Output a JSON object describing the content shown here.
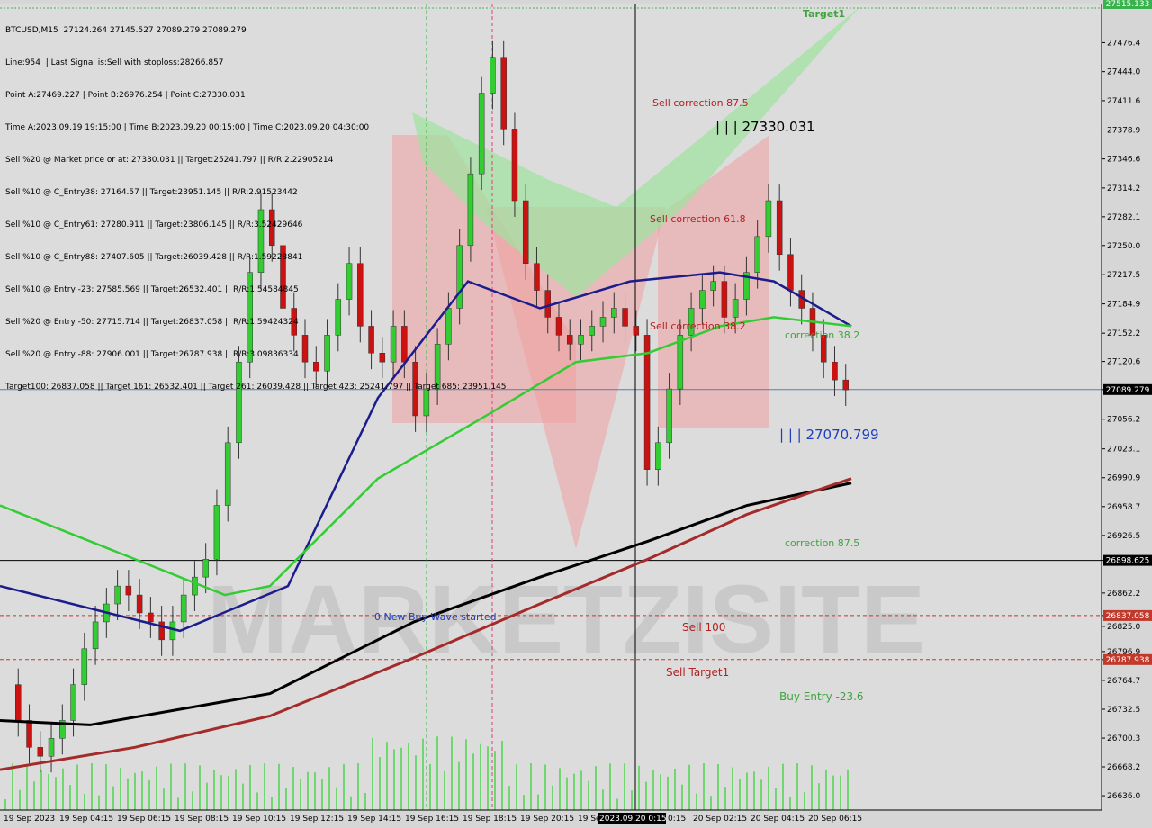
{
  "header": {
    "symbol_line": "BTCUSD,M15  27124.264 27145.527 27089.279 27089.279",
    "lines": [
      "Line:954  | Last Signal is:Sell with stoploss:28266.857",
      "Point A:27469.227 | Point B:26976.254 | Point C:27330.031",
      "Time A:2023.09.19 19:15:00 | Time B:2023.09.20 00:15:00 | Time C:2023.09.20 04:30:00",
      "Sell %20 @ Market price or at: 27330.031 || Target:25241.797 || R/R:2.22905214",
      "Sell %10 @ C_Entry38: 27164.57 || Target:23951.145 || R/R:2.91523442",
      "Sell %10 @ C_Entry61: 27280.911 || Target:23806.145 || R/R:3.52429646",
      "Sell %10 @ C_Entry88: 27407.605 || Target:26039.428 || R/R:1.59228841",
      "Sell %10 @ Entry -23: 27585.569 || Target:26532.401 || R/R:1.54584845",
      "Sell %20 @ Entry -50: 27715.714 || Target:26837.058 || R/R:1.59424324",
      "Sell %20 @ Entry -88: 27906.001 || Target:26787.938 || R/R:3.09836334",
      "Target100: 26837.058 || Target 161: 26532.401 || Target 261: 26039.428 || Target 423: 25241.797 || Target 685: 23951.145"
    ]
  },
  "chart_data": {
    "type": "candlestick",
    "symbol": "BTCUSD",
    "timeframe": "M15",
    "ylim": [
      26620,
      27520
    ],
    "y_ticks": [
      27476.4,
      27444.0,
      27411.6,
      27378.9,
      27346.6,
      27314.2,
      27282.1,
      27250.0,
      27217.5,
      27184.9,
      27152.2,
      27120.6,
      27089.279,
      27056.2,
      27023.1,
      26990.9,
      26958.7,
      26926.5,
      26898.625,
      26862.2,
      26837.058,
      26825.0,
      26796.9,
      26787.938,
      26764.7,
      26732.5,
      26700.3,
      26668.2,
      26636.0
    ],
    "x_tick_labels": [
      "19 Sep 2023",
      "19 Sep 04:15",
      "19 Sep 06:15",
      "19 Sep 08:15",
      "19 Sep 10:15",
      "19 Sep 12:15",
      "19 Sep 14:15",
      "19 Sep 16:15",
      "19 Sep 18:15",
      "19 Sep 20:15",
      "19 Sep",
      "2023.09.20 0:15",
      "0:15",
      "20 Sep 02:15",
      "20 Sep 04:15",
      "20 Sep 06:15"
    ],
    "price_tags": [
      {
        "value": 27520,
        "label": "27515.133",
        "color": "#37b24d"
      },
      {
        "value": 27089.279,
        "label": "27089.279",
        "color": "#000000"
      },
      {
        "value": 26898.625,
        "label": "26898.625",
        "color": "#000000"
      },
      {
        "value": 26837.058,
        "label": "26837.058",
        "color": "#c0392b"
      },
      {
        "value": 26787.938,
        "label": "26787.938",
        "color": "#c0392b"
      }
    ],
    "horizontal_lines": [
      {
        "value": 27515,
        "style": "dotted",
        "color": "#4caf50"
      },
      {
        "value": 27089.279,
        "style": "solid",
        "color": "#5b7bb5"
      },
      {
        "value": 26898.625,
        "style": "solid",
        "color": "#000000"
      },
      {
        "value": 26837.058,
        "style": "dashed",
        "color": "#c0392b"
      },
      {
        "value": 26787.938,
        "style": "dashed",
        "color": "#c0392b"
      }
    ],
    "annotations": [
      {
        "text": "Target1",
        "color": "#3fa33f"
      },
      {
        "text": "Sell correction 87.5",
        "color": "#b22222"
      },
      {
        "text": "| | | 27330.031",
        "color": "#000000"
      },
      {
        "text": "Sell correction 61.8",
        "color": "#b22222"
      },
      {
        "text": "Sell correction 38.2",
        "color": "#b22222"
      },
      {
        "text": "correction 38.2",
        "color": "#3fa33f"
      },
      {
        "text": "| | | 27070.799",
        "color": "#1f3fbf"
      },
      {
        "text": "correction 87.5",
        "color": "#3fa33f"
      },
      {
        "text": "0 New Buy Wave started",
        "color": "#1f3fbf"
      },
      {
        "text": "Sell 100",
        "color": "#b22222"
      },
      {
        "text": "Sell Target1",
        "color": "#b22222"
      },
      {
        "text": "Buy Entry -23.6",
        "color": "#3fa33f"
      }
    ],
    "watermark": "MARKETZISITE",
    "colors": {
      "bull": "#33cc33",
      "bear": "#cc1111",
      "ma_fast": "#1c1c8c",
      "ma_green": "#33cc33",
      "ma_black": "#000000",
      "ma_brown": "#a52a2a"
    }
  }
}
